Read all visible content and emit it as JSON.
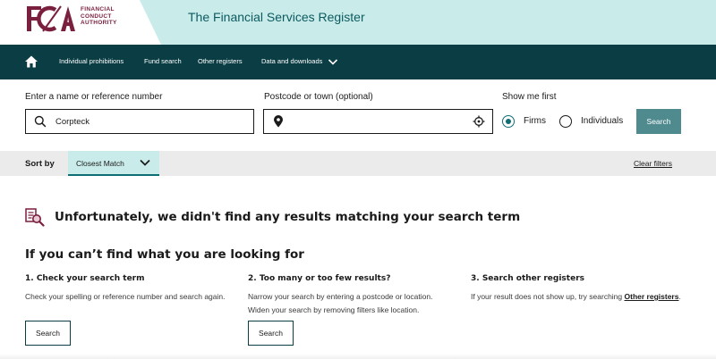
{
  "header": {
    "logo_letters": "FCA",
    "logo_lines": [
      "FINANCIAL",
      "CONDUCT",
      "AUTHORITY"
    ],
    "register_title": "The Financial Services Register"
  },
  "nav": {
    "home_icon": "home-icon",
    "items": [
      {
        "label": "Individual prohibitions"
      },
      {
        "label": "Fund search"
      },
      {
        "label": "Other registers"
      },
      {
        "label": "Data and downloads"
      }
    ]
  },
  "search": {
    "name_label": "Enter a name or reference number",
    "name_value": "Corpteck",
    "postcode_label": "Postcode or town (optional)",
    "postcode_value": "",
    "show_first_label": "Show me first",
    "options": [
      {
        "label": "Firms",
        "checked": true
      },
      {
        "label": "Individuals",
        "checked": false
      }
    ],
    "button_label": "Search"
  },
  "sort": {
    "label": "Sort by",
    "selected": "Closest Match",
    "clear_filters": "Clear filters"
  },
  "results": {
    "no_results_message": "Unfortunately, we didn't find any results matching your search term",
    "help_title": "If you can’t find what you are looking for",
    "columns": [
      {
        "title": "1. Check your search term",
        "body": "Check your spelling or reference number and search again.",
        "button": "Search"
      },
      {
        "title": "2. Too many or too few results?",
        "body": "Narrow your search by entering a postcode or location. Widen your search by removing filters like location.",
        "button": "Search"
      },
      {
        "title": "3. Search other registers",
        "body_prefix": "If your result does not show up, try searching ",
        "link": "Other registers",
        "body_suffix": "."
      }
    ]
  },
  "colors": {
    "brand": "#7a1f3d",
    "nav_bg": "#0a3d44",
    "accent": "#0f6e74",
    "header_band": "#c9ecea",
    "button_bg": "#4f8a8f"
  }
}
